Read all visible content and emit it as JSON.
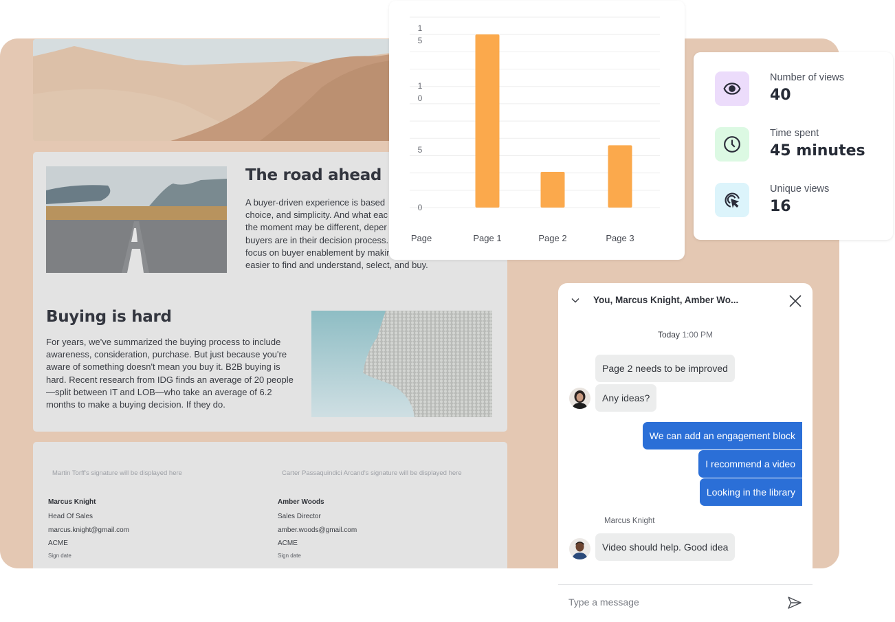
{
  "document": {
    "sections": [
      {
        "title": "The road ahead",
        "body": "A buyer-driven experience is based on choice, and simplicity. And what each buyer needs in the moment may be different, depending on where buyers are in their decision process. focus on buyer enablement by making it easier to find and understand, select, and buy.",
        "body_lines": [
          "A buyer-driven experience is based",
          "choice, and simplicity. And what eac",
          "the moment may be different, deper",
          "buyers are in their decision process.",
          "focus on buyer enablement by makir",
          "easier to find and understand, select, and buy."
        ]
      },
      {
        "title": "Buying is hard",
        "body_lines": [
          "For years, we've summarized the buying process to include",
          "awareness, consideration, purchase. But just because you're",
          "aware of something doesn't mean you buy it. B2B buying is",
          "hard. Recent research from IDG finds an average of 20 people",
          "—split between IT and LOB—who take an average of 6.2",
          "months to make a buying decision. If they do."
        ]
      }
    ],
    "signatures": [
      {
        "placeholder": "Martin Torff's signature will be displayed here",
        "name": "Marcus Knight",
        "title": "Head Of Sales",
        "email": "marcus.knight@gmail.com",
        "company": "ACME",
        "date_label": "Sign date"
      },
      {
        "placeholder": "Carter Passaquindici Arcand's signature will be displayed here",
        "name": "Amber Woods",
        "title": "Sales Director",
        "email": "amber.woods@gmail.com",
        "company": "ACME",
        "date_label": "Sign date"
      }
    ]
  },
  "chart_data": {
    "type": "bar",
    "title": "",
    "xlabel": "Page",
    "ylabel": "",
    "categories": [
      "Page 1",
      "Page 2",
      "Page 3"
    ],
    "values": [
      15,
      3.1,
      5.4
    ],
    "yticks": [
      0,
      5,
      10,
      15
    ],
    "ytick_labels": [
      "0",
      "5",
      "1\n0",
      "1\n5"
    ],
    "ylim": [
      0,
      16.5
    ],
    "grid": true,
    "bar_color": "#fba94c"
  },
  "stats": [
    {
      "icon": "eye-icon",
      "label": "Number of views",
      "value": "40",
      "bg": "#ecdcfb"
    },
    {
      "icon": "clock-icon",
      "label": "Time spent",
      "value": "45 minutes",
      "bg": "#dcf9e3"
    },
    {
      "icon": "cursor-click-icon",
      "label": "Unique views",
      "value": "16",
      "bg": "#dcf4fb"
    }
  ],
  "chat": {
    "title": "You, Marcus Knight, Amber Wo...",
    "date_day": "Today",
    "date_time": "1:00 PM",
    "messages": [
      {
        "from": "other",
        "text": "Page 2 needs to be improved"
      },
      {
        "from": "other",
        "text": "Any ideas?"
      },
      {
        "from": "me",
        "text": "We can add an engagement block"
      },
      {
        "from": "me",
        "text": "I recommend a video"
      },
      {
        "from": "me",
        "text": "Looking in the library"
      },
      {
        "from": "other",
        "sender": "Marcus Knight",
        "text": "Video should help. Good idea"
      }
    ],
    "input_placeholder": "Type a message",
    "accent": "#2b6fd7"
  }
}
